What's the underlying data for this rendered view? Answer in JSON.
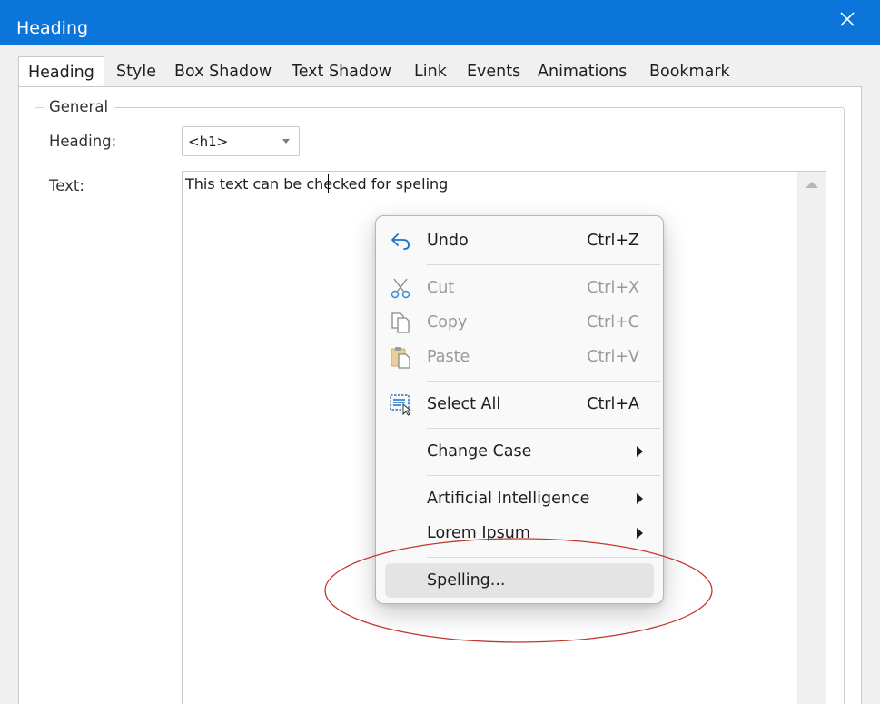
{
  "window": {
    "title": "Heading",
    "titlebar_color": "#0c75d9"
  },
  "tabs": [
    {
      "label": "Heading",
      "active": true
    },
    {
      "label": "Style"
    },
    {
      "label": "Box Shadow"
    },
    {
      "label": "Text Shadow"
    },
    {
      "label": "Link"
    },
    {
      "label": "Events"
    },
    {
      "label": "Animations"
    },
    {
      "label": "Bookmark"
    }
  ],
  "general": {
    "legend": "General",
    "heading_label": "Heading:",
    "heading_value": "<h1>",
    "text_label": "Text:",
    "text_value": "This text can be checked for speling"
  },
  "context_menu": {
    "items": [
      {
        "label": "Undo",
        "shortcut": "Ctrl+Z",
        "icon": "undo-icon",
        "enabled": true
      },
      {
        "label": "Cut",
        "shortcut": "Ctrl+X",
        "icon": "scissors-icon",
        "enabled": false
      },
      {
        "label": "Copy",
        "shortcut": "Ctrl+C",
        "icon": "copy-icon",
        "enabled": false
      },
      {
        "label": "Paste",
        "shortcut": "Ctrl+V",
        "icon": "paste-icon",
        "enabled": false
      },
      {
        "label": "Select All",
        "shortcut": "Ctrl+A",
        "icon": "select-all-icon",
        "enabled": true
      },
      {
        "label": "Change Case",
        "submenu": true,
        "enabled": true
      },
      {
        "label": "Artificial Intelligence",
        "submenu": true,
        "enabled": true
      },
      {
        "label": "Lorem Ipsum",
        "submenu": true,
        "enabled": true
      },
      {
        "label": "Spelling...",
        "enabled": true,
        "highlighted": true
      }
    ]
  },
  "annotation": {
    "shape": "ellipse",
    "color": "#c0392b"
  }
}
